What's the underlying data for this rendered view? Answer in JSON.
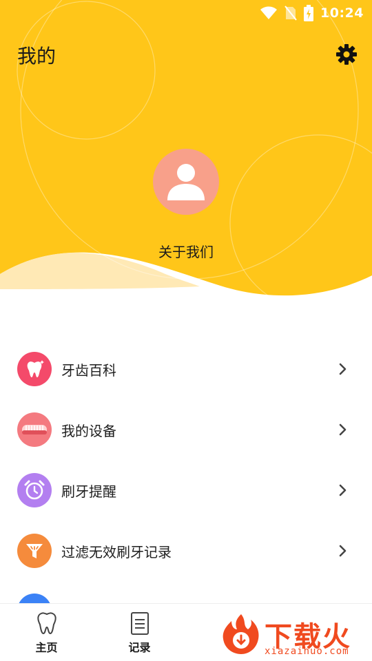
{
  "status_bar": {
    "time": "10:24"
  },
  "header": {
    "title": "我的",
    "settings_icon": "gear-icon",
    "avatar_icon": "user-icon",
    "about_label": "关于我们"
  },
  "colors": {
    "brand_yellow": "#ffc619",
    "avatar_bg": "#f8a08a",
    "wave_light": "#ffe9b5"
  },
  "menu": {
    "items": [
      {
        "label": "牙齿百科",
        "icon": "tooth-icon",
        "color": "#f44a6a"
      },
      {
        "label": "我的设备",
        "icon": "toothbrush-icon",
        "color": "#f47a80"
      },
      {
        "label": "刷牙提醒",
        "icon": "alarm-clock-icon",
        "color": "#b37ff0"
      },
      {
        "label": "过滤无效刷牙记录",
        "icon": "filter-icon",
        "color": "#f58b3c"
      }
    ]
  },
  "tabs": [
    {
      "label": "主页",
      "icon": "tooth-outline-icon"
    },
    {
      "label": "记录",
      "icon": "clipboard-icon"
    }
  ],
  "watermark": {
    "title": "下载火",
    "url": "xiazaihuo.com"
  }
}
